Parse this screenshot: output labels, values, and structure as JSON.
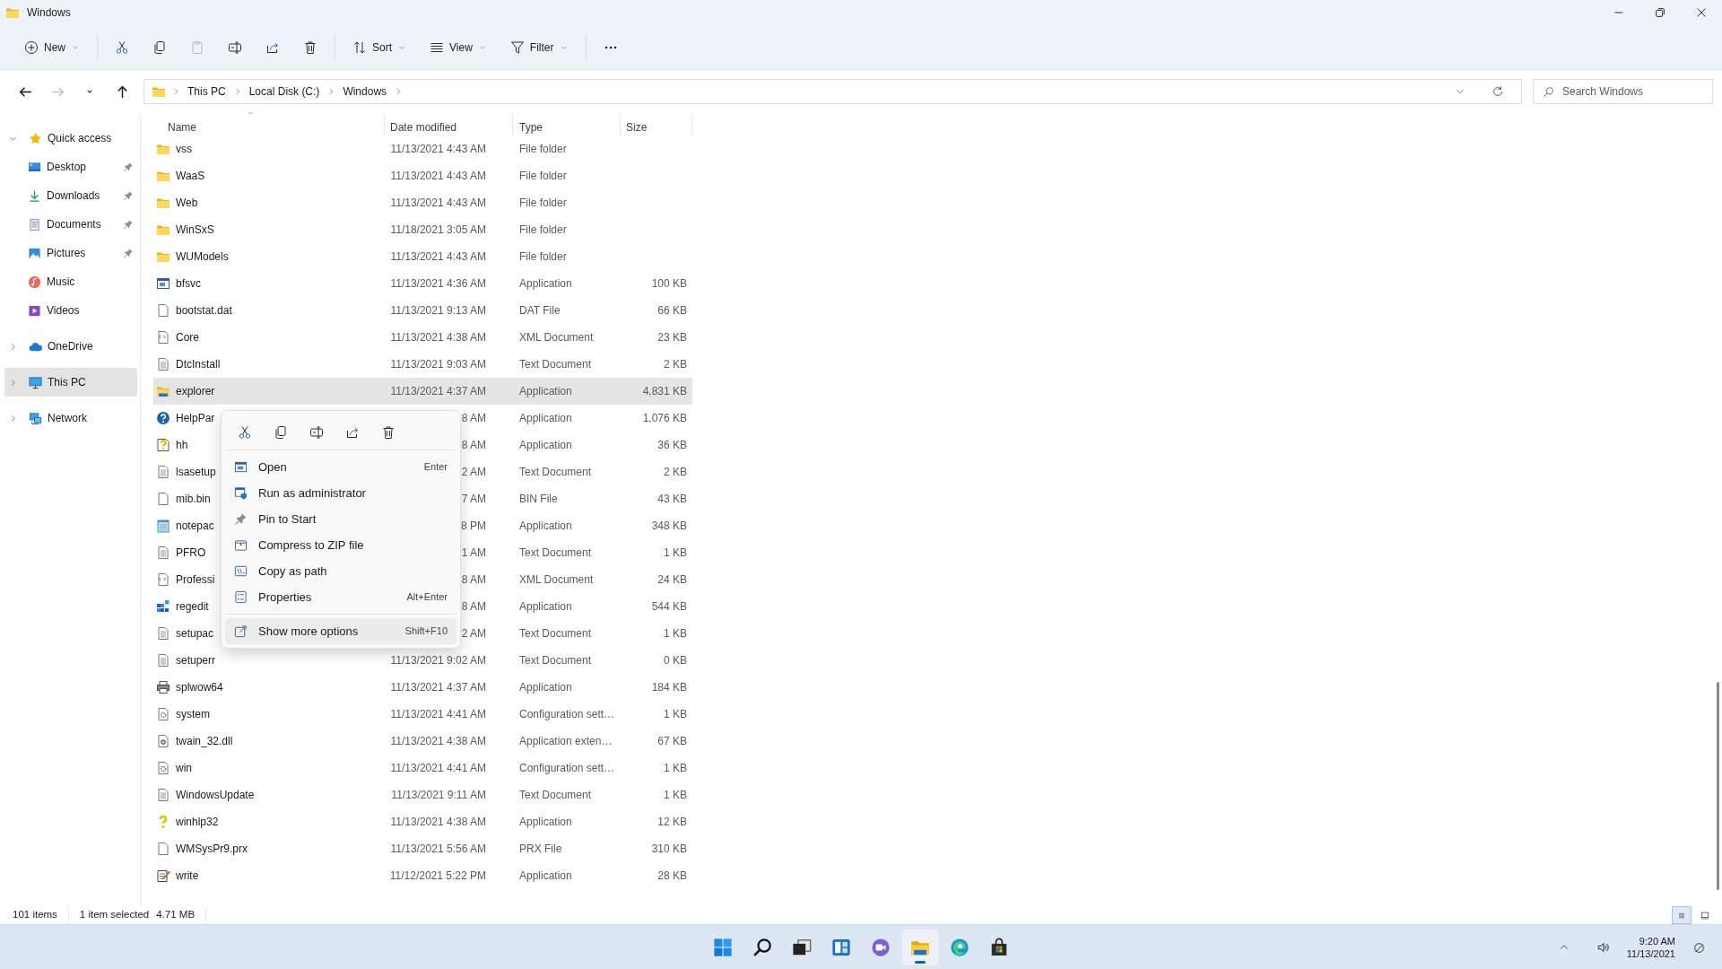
{
  "window": {
    "title": "Windows"
  },
  "toolbar": [
    {
      "kind": "new",
      "label": "New",
      "disabled": false
    },
    {
      "kind": "cut",
      "disabled": false
    },
    {
      "kind": "copy",
      "disabled": false
    },
    {
      "kind": "paste",
      "disabled": true
    },
    {
      "kind": "rename",
      "disabled": false
    },
    {
      "kind": "share",
      "disabled": false
    },
    {
      "kind": "delete",
      "disabled": false
    },
    {
      "kind": "sort",
      "label": "Sort",
      "disabled": false
    },
    {
      "kind": "view",
      "label": "View",
      "disabled": false
    },
    {
      "kind": "filter",
      "label": "Filter",
      "disabled": false
    },
    {
      "kind": "more",
      "disabled": false
    }
  ],
  "navigation": [
    {
      "kind": "back",
      "disabled": false
    },
    {
      "kind": "forward",
      "disabled": true
    },
    {
      "kind": "recent",
      "disabled": false
    },
    {
      "kind": "up",
      "disabled": false
    }
  ],
  "address": {
    "path": [
      "This PC",
      "Local Disk (C:)",
      "Windows"
    ]
  },
  "search": {
    "placeholder": "Search Windows"
  },
  "sidebar": {
    "items": [
      {
        "label": "Quick access",
        "kind": "star",
        "expanded": true,
        "selected": false,
        "children": [
          {
            "label": "Desktop",
            "kind": "desktop",
            "pinned": true,
            "selected": false
          },
          {
            "label": "Downloads",
            "kind": "download",
            "pinned": true,
            "selected": false
          },
          {
            "label": "Documents",
            "kind": "documents",
            "pinned": true,
            "selected": false
          },
          {
            "label": "Pictures",
            "kind": "pictures",
            "pinned": true,
            "selected": false
          },
          {
            "label": "Music",
            "kind": "music",
            "pinned": false,
            "selected": false
          },
          {
            "label": "Videos",
            "kind": "videos",
            "pinned": false,
            "selected": false
          }
        ]
      },
      {
        "label": "OneDrive",
        "kind": "cloud",
        "expanded": false,
        "selected": false
      },
      {
        "label": "This PC",
        "kind": "pc",
        "expanded": false,
        "selected": true
      },
      {
        "label": "Network",
        "kind": "network",
        "expanded": false,
        "selected": false
      }
    ]
  },
  "table": {
    "columns": [
      {
        "label": "Name",
        "sorted": true
      },
      {
        "label": "Date modified",
        "sorted": false
      },
      {
        "label": "Type",
        "sorted": false
      },
      {
        "label": "Size",
        "sorted": false
      }
    ],
    "rows": [
      {
        "name": "vss",
        "date": "11/13/2021 4:43 AM",
        "type": "File folder",
        "kind": "folder",
        "selected": false
      },
      {
        "name": "WaaS",
        "date": "11/13/2021 4:43 AM",
        "type": "File folder",
        "kind": "folder",
        "selected": false
      },
      {
        "name": "Web",
        "date": "11/13/2021 4:43 AM",
        "type": "File folder",
        "kind": "folder",
        "selected": false
      },
      {
        "name": "WinSxS",
        "date": "11/18/2021 3:05 AM",
        "type": "File folder",
        "kind": "folder",
        "selected": false
      },
      {
        "name": "WUModels",
        "date": "11/13/2021 4:43 AM",
        "type": "File folder",
        "kind": "folder",
        "selected": false
      },
      {
        "name": "bfsvc",
        "date": "11/13/2021 4:36 AM",
        "type": "Application",
        "size": "100 KB",
        "kind": "app",
        "selected": false
      },
      {
        "name": "bootstat.dat",
        "date": "11/13/2021 9:13 AM",
        "type": "DAT File",
        "size": "66 KB",
        "kind": "blank",
        "selected": false
      },
      {
        "name": "Core",
        "date": "11/13/2021 4:38 AM",
        "type": "XML Document",
        "size": "23 KB",
        "kind": "xml",
        "selected": false
      },
      {
        "name": "DtcInstall",
        "date": "11/13/2021 9:03 AM",
        "type": "Text Document",
        "size": "2 KB",
        "kind": "text",
        "selected": false
      },
      {
        "name": "explorer",
        "date": "11/13/2021 4:37 AM",
        "type": "Application",
        "size": "4,831 KB",
        "kind": "explorer",
        "selected": true
      },
      {
        "name": "HelpPar",
        "date": "8 AM",
        "type": "Application",
        "size": "1,076 KB",
        "kind": "help",
        "selected": false
      },
      {
        "name": "hh",
        "date": "8 AM",
        "type": "Application",
        "size": "36 KB",
        "kind": "helpdoc",
        "selected": false
      },
      {
        "name": "lsasetup",
        "date": "2 AM",
        "type": "Text Document",
        "size": "2 KB",
        "kind": "text",
        "selected": false
      },
      {
        "name": "mib.bin",
        "date": "7 AM",
        "type": "BIN File",
        "size": "43 KB",
        "kind": "blank",
        "selected": false
      },
      {
        "name": "notepac",
        "date": "8 PM",
        "type": "Application",
        "size": "348 KB",
        "kind": "notepad",
        "selected": false
      },
      {
        "name": "PFRO",
        "date": "1 AM",
        "type": "Text Document",
        "size": "1 KB",
        "kind": "text",
        "selected": false
      },
      {
        "name": "Professi",
        "date": "8 AM",
        "type": "XML Document",
        "size": "24 KB",
        "kind": "xml",
        "selected": false
      },
      {
        "name": "regedit",
        "date": "8 AM",
        "type": "Application",
        "size": "544 KB",
        "kind": "regedit",
        "selected": false
      },
      {
        "name": "setupac",
        "date": "2 AM",
        "type": "Text Document",
        "size": "1 KB",
        "kind": "text",
        "selected": false
      },
      {
        "name": "setuperr",
        "date": "11/13/2021 9:02 AM",
        "type": "Text Document",
        "size": "0 KB",
        "kind": "text",
        "selected": false
      },
      {
        "name": "splwow64",
        "date": "11/13/2021 4:37 AM",
        "type": "Application",
        "size": "184 KB",
        "kind": "printer",
        "selected": false
      },
      {
        "name": "system",
        "date": "11/13/2021 4:41 AM",
        "type": "Configuration sett…",
        "size": "1 KB",
        "kind": "config",
        "selected": false
      },
      {
        "name": "twain_32.dll",
        "date": "11/13/2021 4:38 AM",
        "type": "Application exten…",
        "size": "67 KB",
        "kind": "dll",
        "selected": false
      },
      {
        "name": "win",
        "date": "11/13/2021 4:41 AM",
        "type": "Configuration sett…",
        "size": "1 KB",
        "kind": "config",
        "selected": false
      },
      {
        "name": "WindowsUpdate",
        "date": "11/13/2021 9:11 AM",
        "type": "Text Document",
        "size": "1 KB",
        "kind": "text",
        "selected": false
      },
      {
        "name": "winhlp32",
        "date": "11/13/2021 4:38 AM",
        "type": "Application",
        "size": "12 KB",
        "kind": "winhelp",
        "selected": false
      },
      {
        "name": "WMSysPr9.prx",
        "date": "11/13/2021 5:56 AM",
        "type": "PRX File",
        "size": "310 KB",
        "kind": "blank",
        "selected": false
      },
      {
        "name": "write",
        "date": "11/12/2021 5:22 PM",
        "type": "Application",
        "size": "28 KB",
        "kind": "write",
        "selected": false
      }
    ]
  },
  "context_menu": {
    "quick_actions": [
      {
        "kind": "cut"
      },
      {
        "kind": "copy"
      },
      {
        "kind": "rename"
      },
      {
        "kind": "share"
      },
      {
        "kind": "delete"
      }
    ],
    "items": [
      {
        "label": "Open",
        "shortcut": "Enter",
        "kind": "open",
        "highlighted": false
      },
      {
        "label": "Run as administrator",
        "kind": "admin",
        "highlighted": false
      },
      {
        "label": "Pin to Start",
        "kind": "pin",
        "highlighted": false
      },
      {
        "label": "Compress to ZIP file",
        "kind": "zip",
        "highlighted": false
      },
      {
        "label": "Copy as path",
        "kind": "path",
        "highlighted": false
      },
      {
        "label": "Properties",
        "shortcut": "Alt+Enter",
        "kind": "properties",
        "highlighted": false
      },
      {
        "kind": "separator"
      },
      {
        "label": "Show more options",
        "shortcut": "Shift+F10",
        "kind": "moreoptions",
        "highlighted": true
      }
    ]
  },
  "status_bar": {
    "item_count": "101 items",
    "selection": "1 item selected",
    "selection_size": "4.71 MB"
  },
  "view_toggle": [
    {
      "kind": "details",
      "selected": true
    },
    {
      "kind": "tiles",
      "selected": false
    }
  ],
  "taskbar": {
    "apps": [
      {
        "kind": "start",
        "active": false
      },
      {
        "kind": "search",
        "active": false
      },
      {
        "kind": "taskview",
        "active": false
      },
      {
        "kind": "widgets",
        "active": false
      },
      {
        "kind": "chat",
        "active": false
      },
      {
        "kind": "explorer",
        "active": true
      },
      {
        "kind": "edge",
        "active": false
      },
      {
        "kind": "store",
        "active": false
      }
    ],
    "tray": {
      "time": "9:20 AM",
      "date": "11/13/2021"
    }
  }
}
